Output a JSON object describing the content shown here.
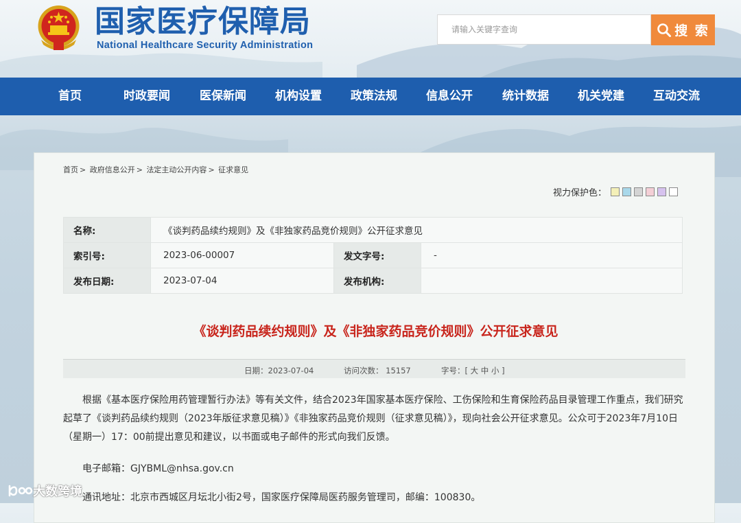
{
  "header": {
    "site_title": "国家医疗保障局",
    "site_subtitle": "National Healthcare Security Administration",
    "search_placeholder": "请输入关键字查询",
    "search_button": "搜 索"
  },
  "nav": [
    "首页",
    "时政要闻",
    "医保新闻",
    "机构设置",
    "政策法规",
    "信息公开",
    "统计数据",
    "机关党建",
    "互动交流"
  ],
  "breadcrumb": [
    "首页",
    "政府信息公开",
    "法定主动公开内容",
    "征求意见"
  ],
  "eye_protection": {
    "label": "视力保护色：",
    "swatches": [
      "#f4f0b8",
      "#a9d8ea",
      "#d4d4d4",
      "#f4cfd6",
      "#d6c2ee",
      "#ffffff"
    ]
  },
  "meta": {
    "name_label": "名称:",
    "name_value": "《谈判药品续约规则》及《非独家药品竞价规则》公开征求意见",
    "index_label": "索引号:",
    "index_value": "2023-06-00007",
    "doc_no_label": "发文字号:",
    "doc_no_value": "-",
    "date_label": "发布日期:",
    "date_value": "2023-07-04",
    "org_label": "发布机构:",
    "org_value": ""
  },
  "article": {
    "title": "《谈判药品续约规则》及《非独家药品竞价规则》公开征求意见",
    "date_text": "日期：2023-07-04",
    "visits_text": "访问次数：  15157",
    "font_text": "字号：[ 大 中 小 ]",
    "paragraph": "根据《基本医疗保险用药管理暂行办法》等有关文件，结合2023年国家基本医疗保险、工伤保险和生育保险药品目录管理工作重点，我们研究起草了《谈判药品续约规则（2023年版征求意见稿）》《非独家药品竞价规则（征求意见稿）》，现向社会公开征求意见。公众可于2023年7月10日（星期一）17：00前提出意见和建议，以书面或电子邮件的形式向我们反馈。",
    "email_line": "电子邮箱：GJYBML@nhsa.gov.cn",
    "address_line": "通讯地址：北京市西城区月坛北小街2号，国家医疗保障局医药服务管理司，邮编：100830。"
  },
  "watermark": "大数跨境",
  "colors": {
    "brand_blue": "#1e5eae",
    "accent_orange": "#f08a3c",
    "title_red": "#c8251c"
  }
}
